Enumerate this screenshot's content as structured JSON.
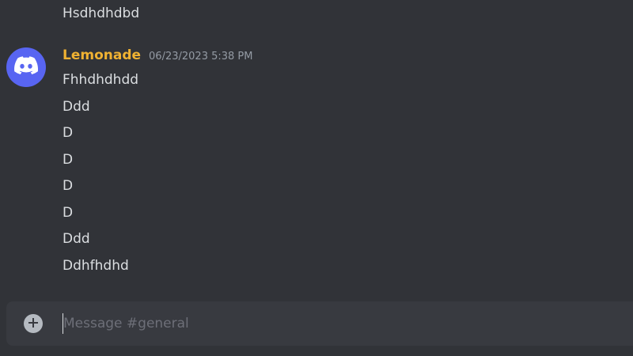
{
  "previous_message": {
    "text": "Hsdhdhdbd"
  },
  "message_group": {
    "username": "Lemonade",
    "timestamp": "06/23/2023 5:38 PM",
    "avatar_icon": "discord-logo-icon",
    "lines": [
      "Fhhdhdhdd",
      "Ddd",
      "D",
      "D",
      "D",
      "D",
      "Ddd",
      "Ddhfhdhd"
    ]
  },
  "composer": {
    "add_icon": "plus-circle-icon",
    "placeholder": "Message #general",
    "value": ""
  },
  "colors": {
    "background": "#313338",
    "composer_bg": "#383a40",
    "username": "#f0b232",
    "avatar_bg": "#5865f2",
    "text": "#dbdee1",
    "muted": "#949ba4"
  }
}
